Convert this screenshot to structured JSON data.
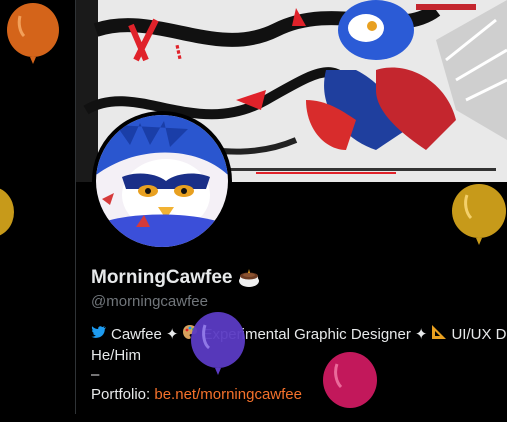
{
  "profile": {
    "display_name": "MorningCawfee",
    "handle": "@morningcawfee"
  },
  "bio": {
    "line1_segments": [
      {
        "icon": "bird-icon",
        "text": "Cawfee"
      },
      {
        "icon": "sparkle-icon",
        "text": ""
      },
      {
        "icon": "palette-icon",
        "text": "Experimental Graphic Designer"
      },
      {
        "icon": "sparkle-icon",
        "text": ""
      },
      {
        "icon": "triangle-ruler-icon",
        "text": "UI/UX D"
      }
    ],
    "line2": "He/Him",
    "line3": "–",
    "portfolio_label": "Portfolio:",
    "portfolio_link": "be.net/morningcawfee"
  },
  "colors": {
    "background": "#000000",
    "text_primary": "#e7e9ea",
    "text_secondary": "#71767b",
    "link": "#f4712b",
    "balloon_orange": "#d4641a",
    "balloon_gold": "#c79a1a",
    "balloon_purple": "#5b3bc4",
    "balloon_magenta": "#c2185b"
  },
  "decorations": {
    "balloons": [
      "balloon-orange",
      "balloon-gold-left",
      "balloon-gold-right",
      "balloon-purple",
      "balloon-magenta"
    ]
  }
}
